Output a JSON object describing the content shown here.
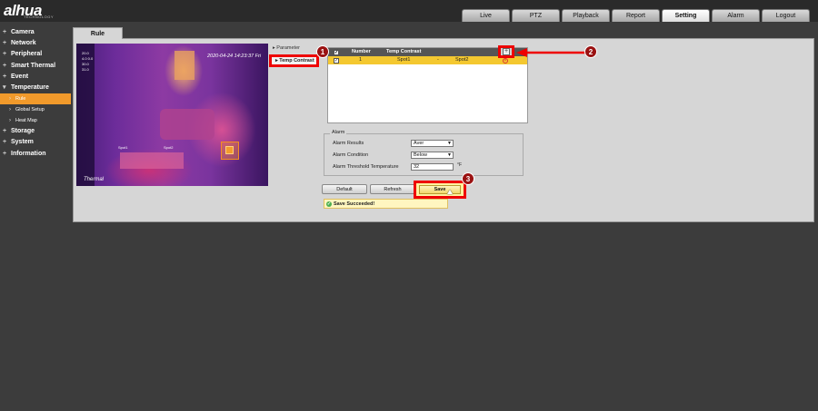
{
  "header": {
    "logo": "alhua",
    "logo_sub": "TECHNOLOGY",
    "nav": [
      "Live",
      "PTZ",
      "Playback",
      "Report",
      "Setting",
      "Alarm",
      "Logout"
    ],
    "active_nav": "Setting"
  },
  "sidebar": {
    "items": [
      "Camera",
      "Network",
      "Peripheral",
      "Smart Thermal",
      "Event",
      "Temperature"
    ],
    "sub_items": [
      "Rule",
      "Global Setup",
      "Heat Map"
    ],
    "after_items": [
      "Storage",
      "System",
      "Information"
    ]
  },
  "tab": {
    "label": "Rule"
  },
  "thermal": {
    "timestamp": "2020-04-24 14:23:37 Fri",
    "channel_name": "Thermal",
    "spot_label": "Spot1",
    "spot2_label": "Spot2",
    "overlay_lines": [
      "20.0",
      "4.0 0.0",
      "30.0",
      "31.0"
    ]
  },
  "menu": {
    "parameter": "Parameter",
    "temp_contrast": "Temp Contrast"
  },
  "table": {
    "headers": {
      "number": "Number",
      "temp_contrast": "Temp Contrast"
    },
    "row": {
      "number": "1",
      "spot_a": "Spot1",
      "dash": "-",
      "spot_b": "Spot2"
    }
  },
  "alarm": {
    "legend": "Alarm",
    "results_label": "Alarm Results",
    "results_value": "Aver",
    "condition_label": "Alarm Condition",
    "condition_value": "Below",
    "threshold_label": "Alarm Threshold Temperature",
    "threshold_value": "32",
    "unit": "°F"
  },
  "buttons": {
    "default": "Default",
    "refresh": "Refresh",
    "save": "Save"
  },
  "status": {
    "message": "Save Succeeded!"
  },
  "callouts": [
    "1",
    "2",
    "3"
  ]
}
